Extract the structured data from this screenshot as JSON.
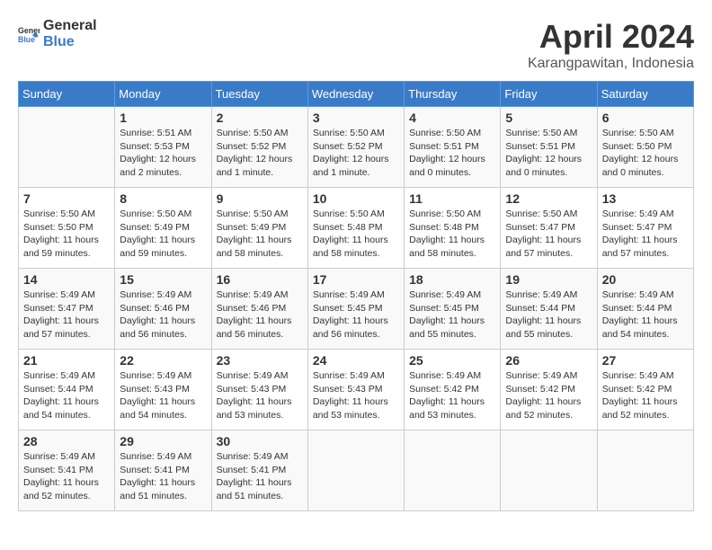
{
  "header": {
    "logo_general": "General",
    "logo_blue": "Blue",
    "month_title": "April 2024",
    "location": "Karangpawitan, Indonesia"
  },
  "calendar": {
    "days_of_week": [
      "Sunday",
      "Monday",
      "Tuesday",
      "Wednesday",
      "Thursday",
      "Friday",
      "Saturday"
    ],
    "weeks": [
      [
        {
          "day": "",
          "sunrise": "",
          "sunset": "",
          "daylight": ""
        },
        {
          "day": "1",
          "sunrise": "Sunrise: 5:51 AM",
          "sunset": "Sunset: 5:53 PM",
          "daylight": "Daylight: 12 hours and 2 minutes."
        },
        {
          "day": "2",
          "sunrise": "Sunrise: 5:50 AM",
          "sunset": "Sunset: 5:52 PM",
          "daylight": "Daylight: 12 hours and 1 minute."
        },
        {
          "day": "3",
          "sunrise": "Sunrise: 5:50 AM",
          "sunset": "Sunset: 5:52 PM",
          "daylight": "Daylight: 12 hours and 1 minute."
        },
        {
          "day": "4",
          "sunrise": "Sunrise: 5:50 AM",
          "sunset": "Sunset: 5:51 PM",
          "daylight": "Daylight: 12 hours and 0 minutes."
        },
        {
          "day": "5",
          "sunrise": "Sunrise: 5:50 AM",
          "sunset": "Sunset: 5:51 PM",
          "daylight": "Daylight: 12 hours and 0 minutes."
        },
        {
          "day": "6",
          "sunrise": "Sunrise: 5:50 AM",
          "sunset": "Sunset: 5:50 PM",
          "daylight": "Daylight: 12 hours and 0 minutes."
        }
      ],
      [
        {
          "day": "7",
          "sunrise": "Sunrise: 5:50 AM",
          "sunset": "Sunset: 5:50 PM",
          "daylight": "Daylight: 11 hours and 59 minutes."
        },
        {
          "day": "8",
          "sunrise": "Sunrise: 5:50 AM",
          "sunset": "Sunset: 5:49 PM",
          "daylight": "Daylight: 11 hours and 59 minutes."
        },
        {
          "day": "9",
          "sunrise": "Sunrise: 5:50 AM",
          "sunset": "Sunset: 5:49 PM",
          "daylight": "Daylight: 11 hours and 58 minutes."
        },
        {
          "day": "10",
          "sunrise": "Sunrise: 5:50 AM",
          "sunset": "Sunset: 5:48 PM",
          "daylight": "Daylight: 11 hours and 58 minutes."
        },
        {
          "day": "11",
          "sunrise": "Sunrise: 5:50 AM",
          "sunset": "Sunset: 5:48 PM",
          "daylight": "Daylight: 11 hours and 58 minutes."
        },
        {
          "day": "12",
          "sunrise": "Sunrise: 5:50 AM",
          "sunset": "Sunset: 5:47 PM",
          "daylight": "Daylight: 11 hours and 57 minutes."
        },
        {
          "day": "13",
          "sunrise": "Sunrise: 5:49 AM",
          "sunset": "Sunset: 5:47 PM",
          "daylight": "Daylight: 11 hours and 57 minutes."
        }
      ],
      [
        {
          "day": "14",
          "sunrise": "Sunrise: 5:49 AM",
          "sunset": "Sunset: 5:47 PM",
          "daylight": "Daylight: 11 hours and 57 minutes."
        },
        {
          "day": "15",
          "sunrise": "Sunrise: 5:49 AM",
          "sunset": "Sunset: 5:46 PM",
          "daylight": "Daylight: 11 hours and 56 minutes."
        },
        {
          "day": "16",
          "sunrise": "Sunrise: 5:49 AM",
          "sunset": "Sunset: 5:46 PM",
          "daylight": "Daylight: 11 hours and 56 minutes."
        },
        {
          "day": "17",
          "sunrise": "Sunrise: 5:49 AM",
          "sunset": "Sunset: 5:45 PM",
          "daylight": "Daylight: 11 hours and 56 minutes."
        },
        {
          "day": "18",
          "sunrise": "Sunrise: 5:49 AM",
          "sunset": "Sunset: 5:45 PM",
          "daylight": "Daylight: 11 hours and 55 minutes."
        },
        {
          "day": "19",
          "sunrise": "Sunrise: 5:49 AM",
          "sunset": "Sunset: 5:44 PM",
          "daylight": "Daylight: 11 hours and 55 minutes."
        },
        {
          "day": "20",
          "sunrise": "Sunrise: 5:49 AM",
          "sunset": "Sunset: 5:44 PM",
          "daylight": "Daylight: 11 hours and 54 minutes."
        }
      ],
      [
        {
          "day": "21",
          "sunrise": "Sunrise: 5:49 AM",
          "sunset": "Sunset: 5:44 PM",
          "daylight": "Daylight: 11 hours and 54 minutes."
        },
        {
          "day": "22",
          "sunrise": "Sunrise: 5:49 AM",
          "sunset": "Sunset: 5:43 PM",
          "daylight": "Daylight: 11 hours and 54 minutes."
        },
        {
          "day": "23",
          "sunrise": "Sunrise: 5:49 AM",
          "sunset": "Sunset: 5:43 PM",
          "daylight": "Daylight: 11 hours and 53 minutes."
        },
        {
          "day": "24",
          "sunrise": "Sunrise: 5:49 AM",
          "sunset": "Sunset: 5:43 PM",
          "daylight": "Daylight: 11 hours and 53 minutes."
        },
        {
          "day": "25",
          "sunrise": "Sunrise: 5:49 AM",
          "sunset": "Sunset: 5:42 PM",
          "daylight": "Daylight: 11 hours and 53 minutes."
        },
        {
          "day": "26",
          "sunrise": "Sunrise: 5:49 AM",
          "sunset": "Sunset: 5:42 PM",
          "daylight": "Daylight: 11 hours and 52 minutes."
        },
        {
          "day": "27",
          "sunrise": "Sunrise: 5:49 AM",
          "sunset": "Sunset: 5:42 PM",
          "daylight": "Daylight: 11 hours and 52 minutes."
        }
      ],
      [
        {
          "day": "28",
          "sunrise": "Sunrise: 5:49 AM",
          "sunset": "Sunset: 5:41 PM",
          "daylight": "Daylight: 11 hours and 52 minutes."
        },
        {
          "day": "29",
          "sunrise": "Sunrise: 5:49 AM",
          "sunset": "Sunset: 5:41 PM",
          "daylight": "Daylight: 11 hours and 51 minutes."
        },
        {
          "day": "30",
          "sunrise": "Sunrise: 5:49 AM",
          "sunset": "Sunset: 5:41 PM",
          "daylight": "Daylight: 11 hours and 51 minutes."
        },
        {
          "day": "",
          "sunrise": "",
          "sunset": "",
          "daylight": ""
        },
        {
          "day": "",
          "sunrise": "",
          "sunset": "",
          "daylight": ""
        },
        {
          "day": "",
          "sunrise": "",
          "sunset": "",
          "daylight": ""
        },
        {
          "day": "",
          "sunrise": "",
          "sunset": "",
          "daylight": ""
        }
      ]
    ]
  }
}
